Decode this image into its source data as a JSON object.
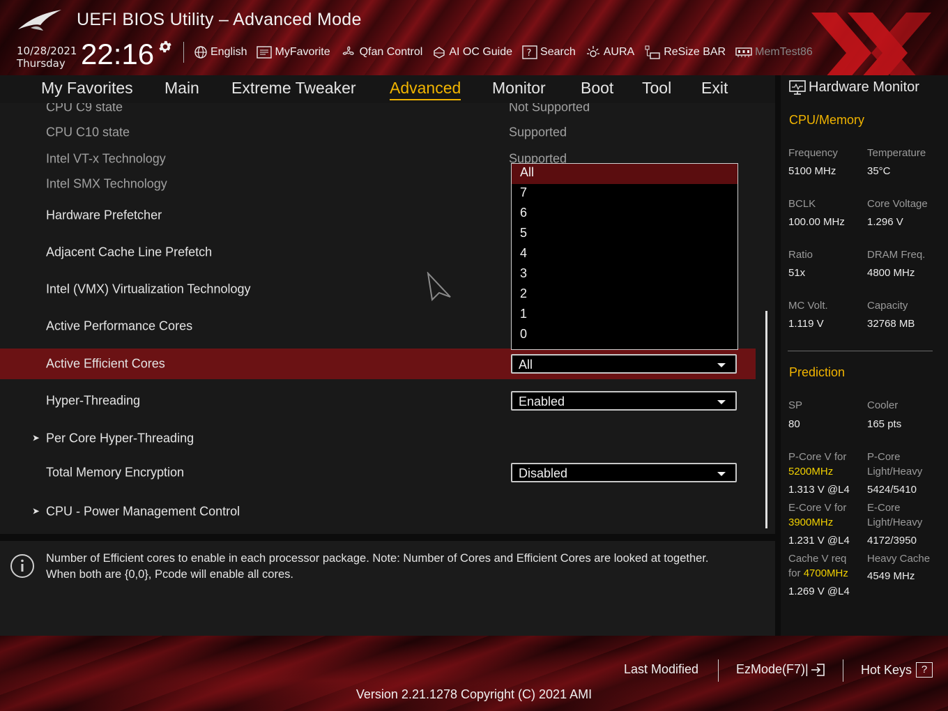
{
  "header": {
    "title": "UEFI BIOS Utility – Advanced Mode",
    "date": "10/28/2021",
    "day": "Thursday",
    "time": "22:16",
    "tools": [
      {
        "label": "English",
        "icon": "globe-icon"
      },
      {
        "label": "MyFavorite",
        "icon": "favorite-list-icon"
      },
      {
        "label": "Qfan Control",
        "icon": "fan-icon"
      },
      {
        "label": "AI OC Guide",
        "icon": "ai-chip-icon"
      },
      {
        "label": "Search",
        "icon": "help-search-icon"
      },
      {
        "label": "AURA",
        "icon": "aura-light-icon"
      },
      {
        "label": "ReSize BAR",
        "icon": "resize-bar-icon"
      },
      {
        "label": "MemTest86",
        "icon": "memory-icon"
      }
    ]
  },
  "nav": {
    "tabs": [
      "My Favorites",
      "Main",
      "Extreme Tweaker",
      "Advanced",
      "Monitor",
      "Boot",
      "Tool",
      "Exit"
    ],
    "active": "Advanced"
  },
  "settings": {
    "c9_label": "CPU C9 state",
    "c9_value": "Not Supported",
    "c10_label": "CPU C10 state",
    "c10_value": "Supported",
    "vtx_label": "Intel VT-x Technology",
    "vtx_value": "Supported",
    "smx_label": "Intel SMX Technology",
    "prefetcher_label": "Hardware Prefetcher",
    "adjacent_label": "Adjacent Cache Line Prefetch",
    "vmx_label": "Intel (VMX) Virtualization Technology",
    "perf_cores_label": "Active Performance Cores",
    "eff_cores_label": "Active Efficient Cores",
    "eff_cores_value": "All",
    "ht_label": "Hyper-Threading",
    "ht_value": "Enabled",
    "per_core_ht_label": "Per Core Hyper-Threading",
    "tme_label": "Total Memory Encryption",
    "tme_value": "Disabled",
    "pm_label": "CPU - Power Management Control"
  },
  "dropdown": {
    "options": [
      "All",
      "7",
      "6",
      "5",
      "4",
      "3",
      "2",
      "1",
      "0"
    ],
    "highlighted": "All"
  },
  "info": {
    "line1": "Number of Efficient cores to enable in each processor package. Note: Number of Cores and Efficient Cores are looked at together.",
    "line2": "When both are {0,0}, Pcode will enable all cores."
  },
  "hw_monitor": {
    "title": "Hardware Monitor",
    "cpu_mem_title": "CPU/Memory",
    "frequency_label": "Frequency",
    "frequency_value": "5100 MHz",
    "temperature_label": "Temperature",
    "temperature_value": "35°C",
    "bclk_label": "BCLK",
    "bclk_value": "100.00 MHz",
    "core_voltage_label": "Core Voltage",
    "core_voltage_value": "1.296 V",
    "ratio_label": "Ratio",
    "ratio_value": "51x",
    "dram_label": "DRAM Freq.",
    "dram_value": "4800 MHz",
    "mcvolt_label": "MC Volt.",
    "mcvolt_value": "1.119 V",
    "capacity_label": "Capacity",
    "capacity_value": "32768 MB",
    "prediction_title": "Prediction",
    "sp_label": "SP",
    "sp_value": "80",
    "cooler_label": "Cooler",
    "cooler_value": "165 pts",
    "pcore_v_label": "P-Core V for",
    "pcore_v_freq": "5200MHz",
    "pcore_v_value": "1.313 V @L4",
    "pcore_lh_label1": "P-Core",
    "pcore_lh_label2": "Light/Heavy",
    "pcore_lh_value": "5424/5410",
    "ecore_v_label": "E-Core V for",
    "ecore_v_freq": "3900MHz",
    "ecore_v_value": "1.231 V @L4",
    "ecore_lh_label1": "E-Core",
    "ecore_lh_label2": "Light/Heavy",
    "ecore_lh_value": "4172/3950",
    "cache_v_label1": "Cache V req",
    "cache_v_label2": "for",
    "cache_v_freq": "4700MHz",
    "cache_v_value": "1.269 V @L4",
    "heavy_cache_label": "Heavy Cache",
    "heavy_cache_value": "4549 MHz"
  },
  "footer": {
    "last_modified": "Last Modified",
    "ezmode": "EzMode(F7)|",
    "hotkeys": "Hot Keys",
    "hotkeys_key": "?",
    "version": "Version 2.21.1278 Copyright (C) 2021 AMI"
  },
  "colors": {
    "accent": "#f1b400",
    "selected_row": "#6b1214",
    "highlight_value": "#f1d000"
  }
}
